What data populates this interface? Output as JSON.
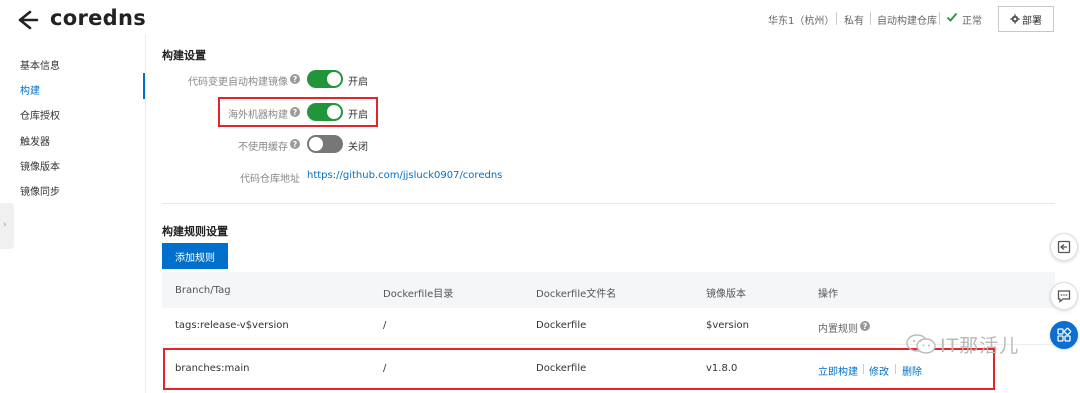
{
  "header": {
    "title": "coredns",
    "region": "华东1（杭州）",
    "visibility": "私有",
    "repo_type": "自动构建仓库",
    "status": "正常",
    "deploy_label": "部署"
  },
  "sidebar": {
    "items": [
      {
        "label": "基本信息"
      },
      {
        "label": "构建"
      },
      {
        "label": "仓库授权"
      },
      {
        "label": "触发器"
      },
      {
        "label": "镜像版本"
      },
      {
        "label": "镜像同步"
      }
    ],
    "active_index": 1,
    "edge_tab_glyph": "›"
  },
  "build_settings": {
    "title": "构建设置",
    "rows": [
      {
        "label": "代码变更自动构建镜像",
        "state": "开启",
        "on": true
      },
      {
        "label": "海外机器构建",
        "state": "开启",
        "on": true
      },
      {
        "label": "不使用缓存",
        "state": "关闭",
        "on": false
      }
    ],
    "repo_label": "代码仓库地址",
    "repo_url": "https://github.com/jjsluck0907/coredns",
    "help_glyph": "?"
  },
  "build_rules": {
    "title": "构建规则设置",
    "add_label": "添加规则",
    "columns": [
      "Branch/Tag",
      "Dockerfile目录",
      "Dockerfile文件名",
      "镜像版本",
      "操作"
    ],
    "rows": [
      {
        "branch": "tags:release-v$version",
        "dir": "/",
        "file": "Dockerfile",
        "version": "$version",
        "action_text": "内置规则"
      },
      {
        "branch": "branches:main",
        "dir": "/",
        "file": "Dockerfile",
        "version": "v1.8.0",
        "actions": [
          "立即构建",
          "修改",
          "删除"
        ]
      }
    ]
  },
  "watermark": "IT那活儿",
  "colors": {
    "accent": "#0070cc",
    "toggle_on": "#22953b",
    "toggle_off": "#777777",
    "highlight_box": "#e4242a",
    "status_ok": "#22953b"
  },
  "icons": {
    "back": "arrow-left-icon",
    "status": "check-icon",
    "deploy": "gear-icon",
    "help": "question-circle-icon",
    "float_1": "document-icon",
    "float_2": "chat-icon",
    "float_3": "apps-grid-icon",
    "watermark": "wechat-icon"
  }
}
